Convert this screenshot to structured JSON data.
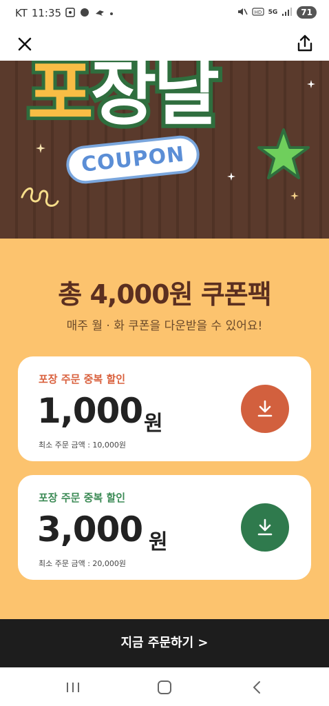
{
  "status_bar": {
    "carrier": "KT",
    "time": "11:35",
    "battery": "71",
    "network": "5G"
  },
  "banner": {
    "title_chars": [
      "포",
      "장",
      "날"
    ],
    "badge": "COUPON"
  },
  "promo": {
    "title": "총 4,000원 쿠폰팩",
    "subtitle": "매주 월 · 화 쿠폰을 다운받을 수 있어요!"
  },
  "coupons": [
    {
      "label": "포장 주문 중복 할인",
      "amount": "1,000",
      "unit": "원",
      "minimum": "최소 주문 금액 : 10,000원",
      "color": "#d2603e"
    },
    {
      "label": "포장 주문 중복 할인",
      "amount": "3,000",
      "unit": "원",
      "minimum": "최소 주문 금액 : 20,000원",
      "color": "#2f7a4d"
    }
  ],
  "cta": {
    "label": "지금 주문하기 >"
  },
  "colors": {
    "banner_bg": "#5a3a2c",
    "promo_bg": "#fcc36e",
    "title_text": "#5b2f20",
    "cta_bg": "#1d1d1d"
  }
}
